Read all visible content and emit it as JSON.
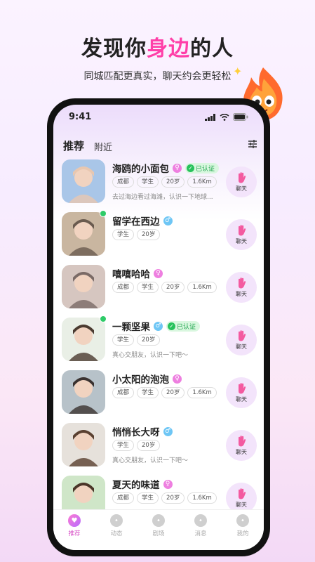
{
  "promo": {
    "headline_pre": "发现你",
    "headline_highlight": "身边",
    "headline_post": "的人",
    "subtitle": "同城匹配更真实，聊天约会更轻松"
  },
  "status_bar": {
    "time": "9:41"
  },
  "tabs": [
    {
      "label": "推荐"
    },
    {
      "label": "附近"
    }
  ],
  "chat_label": "聊天",
  "verified_label": "已认证",
  "users": [
    {
      "name": "海鸥的小面包",
      "gender": "female",
      "verified": true,
      "online": false,
      "tags": [
        "成都",
        "学生",
        "20岁",
        "1.6Km"
      ],
      "bio": "去过海边看过海滩，认识一下地球..."
    },
    {
      "name": "留学在西边",
      "gender": "male",
      "verified": false,
      "online": true,
      "tags": [
        "学生",
        "20岁"
      ],
      "bio": ""
    },
    {
      "name": "嘻嘻哈哈",
      "gender": "female",
      "verified": false,
      "online": false,
      "tags": [
        "成都",
        "学生",
        "20岁",
        "1.6Km"
      ],
      "bio": ""
    },
    {
      "name": "一颗坚果",
      "gender": "male",
      "verified": true,
      "online": true,
      "tags": [
        "学生",
        "20岁"
      ],
      "bio": "真心交朋友，认识一下吧～"
    },
    {
      "name": "小太阳的泡泡",
      "gender": "female",
      "verified": false,
      "online": false,
      "tags": [
        "成都",
        "学生",
        "20岁",
        "1.6Km"
      ],
      "bio": ""
    },
    {
      "name": "悄悄长大呀",
      "gender": "male",
      "verified": false,
      "online": false,
      "tags": [
        "学生",
        "20岁"
      ],
      "bio": "真心交朋友，认识一下吧～"
    },
    {
      "name": "夏天的味道",
      "gender": "female",
      "verified": false,
      "online": false,
      "tags": [
        "成都",
        "学生",
        "20岁",
        "1.6Km"
      ],
      "bio": ""
    }
  ],
  "bottom_nav": [
    {
      "label": "推荐",
      "icon": "heart-icon",
      "active": true
    },
    {
      "label": "动态",
      "icon": "compass-icon",
      "active": false
    },
    {
      "label": "剧场",
      "icon": "book-icon",
      "active": false
    },
    {
      "label": "消息",
      "icon": "message-icon",
      "active": false
    },
    {
      "label": "我的",
      "icon": "profile-icon",
      "active": false
    }
  ],
  "colors": {
    "accent": "#ff3fa8",
    "online": "#2ecb68",
    "verified": "#27c25c"
  }
}
